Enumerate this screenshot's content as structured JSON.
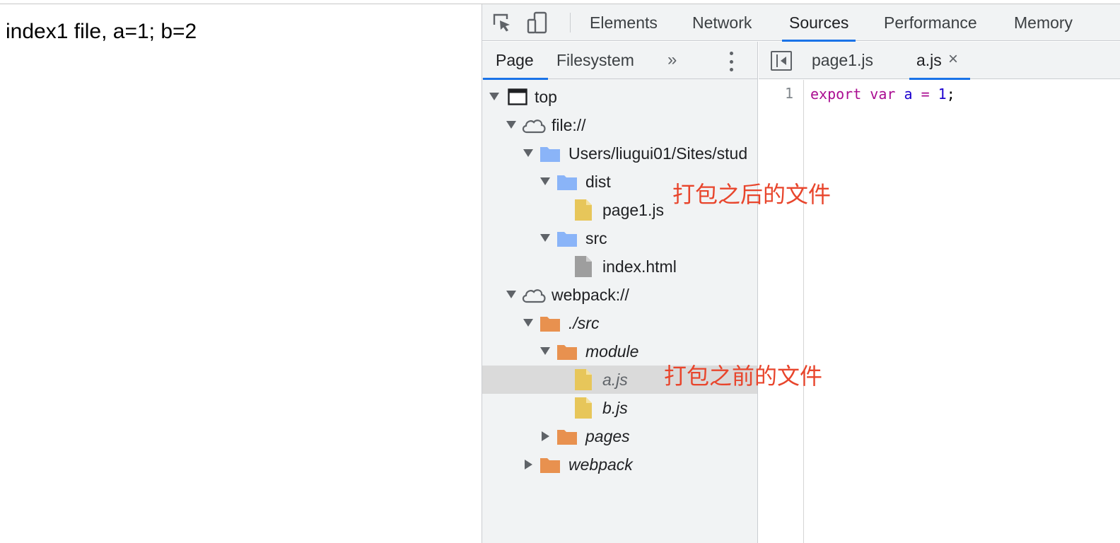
{
  "page": {
    "text": "index1 file, a=1; b=2"
  },
  "devtools": {
    "main_tabs": [
      "Elements",
      "Network",
      "Sources",
      "Performance",
      "Memory"
    ],
    "active_main_tab": "Sources",
    "toolbar_icons": [
      "inspect-element-icon",
      "device-toolbar-icon"
    ],
    "navigator": {
      "tabs": [
        "Page",
        "Filesystem"
      ],
      "active_tab": "Page",
      "more_tabs": "»",
      "tree": [
        {
          "label": "top",
          "icon": "frame-icon",
          "expanded": true
        },
        {
          "label": "file://",
          "icon": "cloud-icon",
          "expanded": true
        },
        {
          "label": "Users/liugui01/Sites/stud",
          "icon": "folder-icon",
          "expanded": true
        },
        {
          "label": "dist",
          "icon": "folder-icon",
          "expanded": true
        },
        {
          "label": "page1.js",
          "icon": "js-file-icon"
        },
        {
          "label": "src",
          "icon": "folder-icon",
          "expanded": true
        },
        {
          "label": "index.html",
          "icon": "html-file-icon"
        },
        {
          "label": "webpack://",
          "icon": "cloud-icon",
          "expanded": true
        },
        {
          "label": "./src",
          "icon": "folder-icon",
          "expanded": true
        },
        {
          "label": "module",
          "icon": "folder-icon",
          "expanded": true
        },
        {
          "label": "a.js",
          "icon": "js-file-icon",
          "selected": true
        },
        {
          "label": "b.js",
          "icon": "js-file-icon"
        },
        {
          "label": "pages",
          "icon": "folder-icon",
          "expanded": false
        },
        {
          "label": "webpack",
          "icon": "folder-icon",
          "expanded": false
        }
      ]
    },
    "editor": {
      "tabs": [
        "page1.js",
        "a.js"
      ],
      "active_tab": "a.js",
      "close_glyph": "×",
      "line_number": "1",
      "code": {
        "keyword1": "export",
        "keyword2": "var",
        "identifier": "a",
        "operator": "=",
        "number": "1",
        "semicolon": ";"
      }
    }
  },
  "annotations": {
    "after_bundle": "打包之后的文件",
    "before_bundle": "打包之前的文件"
  },
  "colors": {
    "accent": "#1a73e8",
    "annotation": "#e8452c",
    "folder_blue": "#8ab4f8",
    "folder_orange": "#e8914f",
    "js_file": "#e7c65a",
    "html_file": "#9e9e9e"
  }
}
